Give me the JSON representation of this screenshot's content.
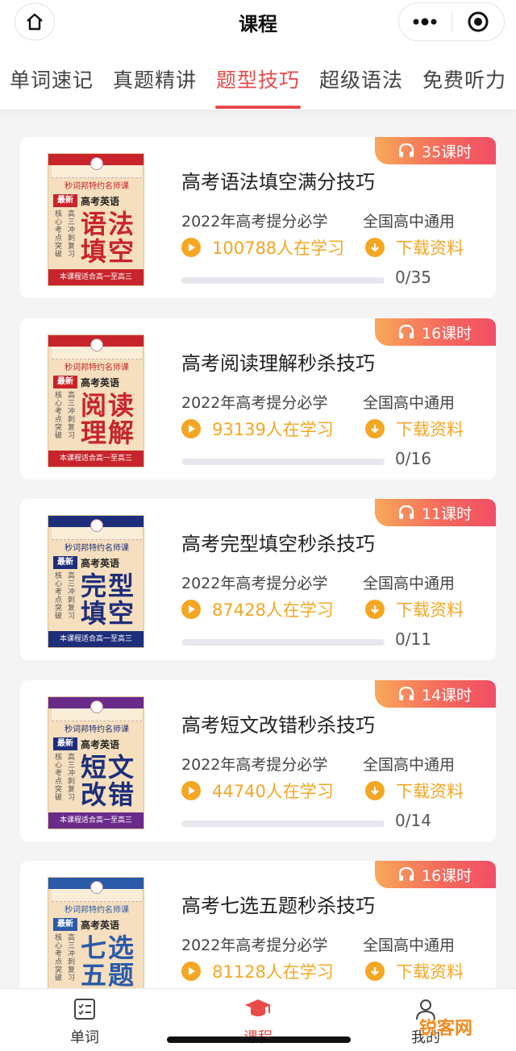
{
  "header": {
    "title": "课程"
  },
  "tabs": [
    {
      "label": "单词速记",
      "active": false
    },
    {
      "label": "真题精讲",
      "active": false
    },
    {
      "label": "题型技巧",
      "active": true
    },
    {
      "label": "超级语法",
      "active": false
    },
    {
      "label": "免费听力",
      "active": false
    }
  ],
  "cover_common": {
    "brand": "秒词邦特约名师课",
    "new_tag": "最新",
    "subject": "高考英语",
    "side_a": "核心考点突破",
    "side_b": "高三冲刺复习",
    "footer": "本课程适合高一至高三"
  },
  "courses": [
    {
      "title": "高考语法填空满分技巧",
      "badge": "35课时",
      "tag1": "2022年高考提分必学",
      "tag2": "全国高中通用",
      "learners": "100788人在学习",
      "download": "下载资料",
      "progress_text": "0/35",
      "progress": 0,
      "cover_title": "语法填空",
      "cover_band_color": "#c8242b",
      "cover_text_color": "#c8242b",
      "icon_gift": "gift-icon"
    },
    {
      "title": "高考阅读理解秒杀技巧",
      "badge": "16课时",
      "tag1": "2022年高考提分必学",
      "tag2": "全国高中通用",
      "learners": "93139人在学习",
      "download": "下载资料",
      "progress_text": "0/16",
      "progress": 0,
      "cover_title": "阅读理解",
      "cover_band_color": "#c8242b",
      "cover_text_color": "#c8242b"
    },
    {
      "title": "高考完型填空秒杀技巧",
      "badge": "11课时",
      "tag1": "2022年高考提分必学",
      "tag2": "全国高中通用",
      "learners": "87428人在学习",
      "download": "下载资料",
      "progress_text": "0/11",
      "progress": 0,
      "cover_title": "完型填空",
      "cover_band_color": "#1e2e7a",
      "cover_text_color": "#1e2e7a"
    },
    {
      "title": "高考短文改错秒杀技巧",
      "badge": "14课时",
      "tag1": "2022年高考提分必学",
      "tag2": "全国高中通用",
      "learners": "44740人在学习",
      "download": "下载资料",
      "progress_text": "0/14",
      "progress": 0,
      "cover_title": "短文改错",
      "cover_band_color": "#6a2a8a",
      "cover_text_color": "#1e2e7a"
    },
    {
      "title": "高考七选五题秒杀技巧",
      "badge": "16课时",
      "tag1": "2022年高考提分必学",
      "tag2": "全国高中通用",
      "learners": "81128人在学习",
      "download": "下载资料",
      "progress_text": "",
      "progress": 0,
      "cover_title": "七选五题",
      "cover_band_color": "#2b5aa8",
      "cover_text_color": "#2b5aa8"
    }
  ],
  "bottom_nav": [
    {
      "label": "单词",
      "icon": "checklist-icon",
      "active": false
    },
    {
      "label": "课程",
      "icon": "graduation-cap-icon",
      "active": true
    },
    {
      "label": "我的",
      "icon": "user-icon",
      "active": false
    }
  ],
  "watermark": "锐客网",
  "colors": {
    "accent": "#e84a4a",
    "orange": "#f5a623",
    "badge_gradient_start": "#f8a85a",
    "badge_gradient_end": "#f04e64"
  }
}
